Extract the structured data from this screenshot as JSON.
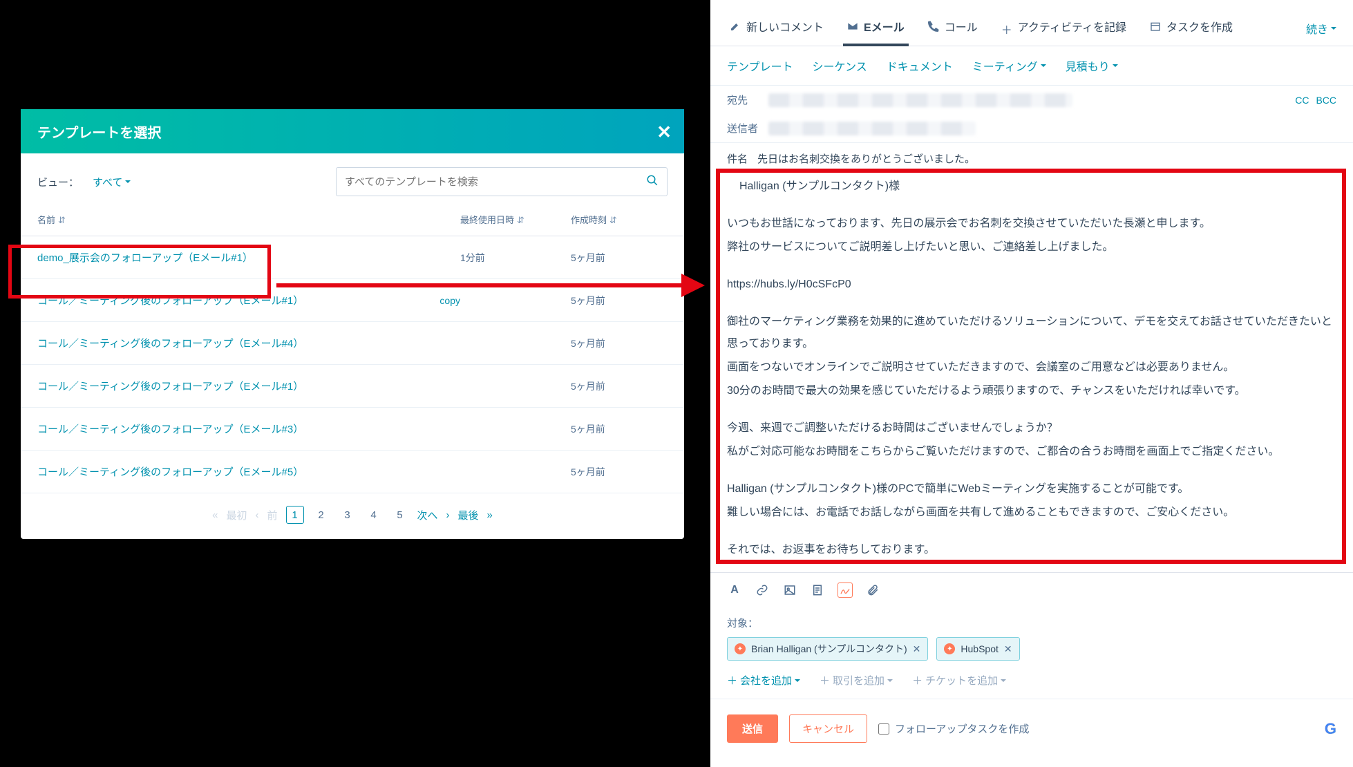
{
  "modal": {
    "title": "テンプレートを選択",
    "view_label": "ビュー：",
    "view_value": "すべて",
    "search_placeholder": "すべてのテンプレートを検索",
    "columns": {
      "name": "名前",
      "last": "最終使用日時",
      "created": "作成時刻"
    },
    "rows": [
      {
        "name": "demo_展示会のフォローアップ（Eメール#1）",
        "last": "1分前",
        "created": "5ヶ月前"
      },
      {
        "name": "コール／ミーティング後のフォローアップ（Eメール#1）",
        "copy": "copy",
        "last": "",
        "created": "5ヶ月前"
      },
      {
        "name": "コール／ミーティング後のフォローアップ（Eメール#4）",
        "last": "",
        "created": "5ヶ月前"
      },
      {
        "name": "コール／ミーティング後のフォローアップ（Eメール#1）",
        "last": "",
        "created": "5ヶ月前"
      },
      {
        "name": "コール／ミーティング後のフォローアップ（Eメール#3）",
        "last": "",
        "created": "5ヶ月前"
      },
      {
        "name": "コール／ミーティング後のフォローアップ（Eメール#5）",
        "last": "",
        "created": "5ヶ月前"
      }
    ],
    "pager": {
      "first": "最初",
      "prev": "前",
      "pages": [
        "1",
        "2",
        "3",
        "4",
        "5"
      ],
      "next": "次へ",
      "last": "最後"
    }
  },
  "tabs": {
    "comment": "新しいコメント",
    "email": "Eメール",
    "call": "コール",
    "activity": "アクティビティを記録",
    "task": "タスクを作成",
    "more": "続き"
  },
  "subnav": {
    "template": "テンプレート",
    "sequence": "シーケンス",
    "document": "ドキュメント",
    "meeting": "ミーティング",
    "quote": "見積もり"
  },
  "addr": {
    "to_label": "宛先",
    "from_label": "送信者",
    "cc": "CC",
    "bcc": "BCC"
  },
  "subject": {
    "label": "件名",
    "text": "先日はお名刺交換をありがとうございました。"
  },
  "body": {
    "greet": "Halligan (サンプルコンタクト)様",
    "p1": "いつもお世話になっております、先日の展示会でお名刺を交換させていただいた長瀬と申します。",
    "p2": "弊社のサービスについてご説明差し上げたいと思い、ご連絡差し上げました。",
    "url": "https://hubs.ly/H0cSFcP0",
    "p3": "御社のマーケティング業務を効果的に進めていただけるソリューションについて、デモを交えてお話させていただきたいと思っております。",
    "p4": "画面をつないでオンラインでご説明させていただきますので、会議室のご用意などは必要ありません。",
    "p5": "30分のお時間で最大の効果を感じていただけるよう頑張りますので、チャンスをいただければ幸いです。",
    "p6": "今週、来週でご調整いただけるお時間はございませんでしょうか？",
    "p7": "私がご対応可能なお時間をこちらからご覧いただけますので、ご都合の合うお時間を画面上でご指定ください。",
    "p8": "Halligan (サンプルコンタクト)様のPCで簡単にWebミーティングを実施することが可能です。",
    "p9": "難しい場合には、お電話でお話しながら画面を共有して進めることもできますので、ご安心ください。",
    "p10": "それでは、お返事をお待ちしております。"
  },
  "assoc": {
    "label": "対象：",
    "chips": [
      "Brian Halligan (サンプルコンタクト)",
      "HubSpot"
    ],
    "add_company": "会社を追加",
    "add_deal": "取引を追加",
    "add_ticket": "チケットを追加"
  },
  "footer": {
    "send": "送信",
    "cancel": "キャンセル",
    "followup": "フォローアップタスクを作成"
  }
}
